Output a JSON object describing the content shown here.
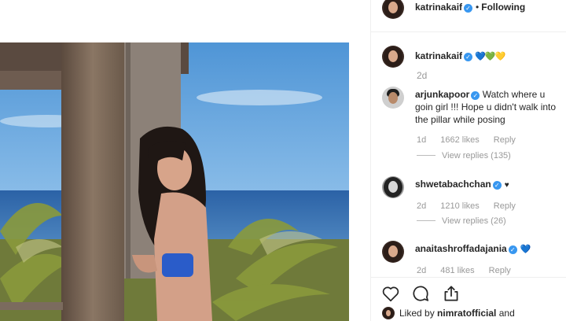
{
  "header": {
    "username": "katrinakaif",
    "separator": "•",
    "follow_status": "Following"
  },
  "caption": {
    "username": "katrinakaif",
    "hearts": [
      "💙",
      "💚",
      "💛"
    ],
    "time": "2d"
  },
  "comments": [
    {
      "username": "arjunkapoor",
      "text": "Watch where u goin girl !!! Hope u didn't walk into the pillar while posing",
      "time": "1d",
      "likes": "1662 likes",
      "reply": "Reply",
      "view_replies": "View replies (135)"
    },
    {
      "username": "shwetabachchan",
      "emoji": "♥",
      "time": "2d",
      "likes": "1210 likes",
      "reply": "Reply",
      "view_replies": "View replies (26)"
    },
    {
      "username": "anaitashroffadajania",
      "emoji": "💙",
      "time": "2d",
      "likes": "481 likes",
      "reply": "Reply"
    }
  ],
  "actions": {
    "like_icon": "heart-outline-icon",
    "comment_icon": "comment-bubble-icon",
    "share_icon": "share-icon"
  },
  "liked_by": {
    "prefix": "Liked by",
    "username": "nimratofficial",
    "suffix": "and"
  },
  "colors": {
    "verified": "#3897f0",
    "muted_text": "#999999",
    "sky": "#5aa0d8",
    "sea": "#2f6fb0",
    "bikini": "#2a5cc9"
  }
}
